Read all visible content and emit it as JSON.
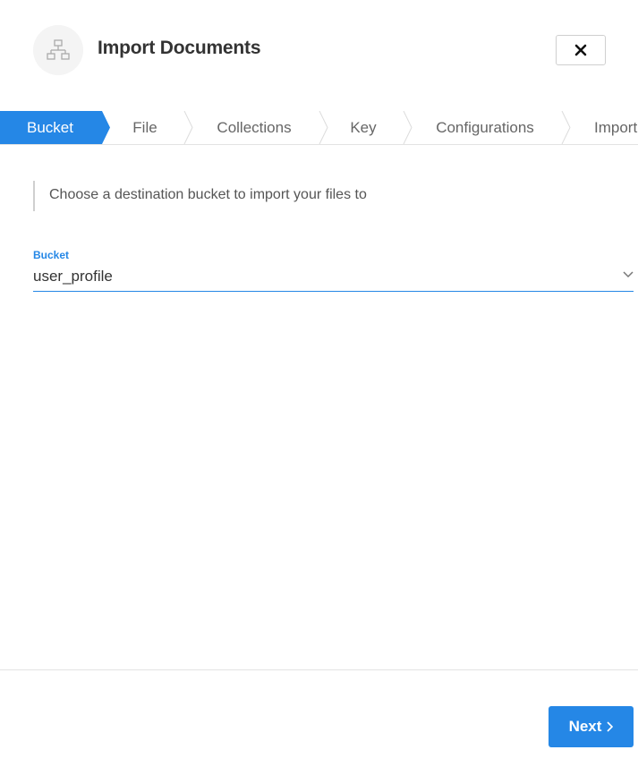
{
  "header": {
    "title": "Import Documents",
    "logo_icon": "network-icon",
    "close_icon": "close-icon"
  },
  "steps": [
    {
      "label": "Bucket",
      "active": true
    },
    {
      "label": "File",
      "active": false
    },
    {
      "label": "Collections",
      "active": false
    },
    {
      "label": "Key",
      "active": false
    },
    {
      "label": "Configurations",
      "active": false
    },
    {
      "label": "Import",
      "active": false
    }
  ],
  "main": {
    "hint": "Choose a destination bucket to import your files to",
    "bucket_field": {
      "label": "Bucket",
      "value": "user_profile",
      "icon": "chevron-down-icon"
    }
  },
  "footer": {
    "next_label": "Next",
    "next_icon": "chevron-right-icon"
  },
  "colors": {
    "accent": "#2587e6",
    "border": "#e3e3e3",
    "text": "#333333",
    "muted": "#666666"
  }
}
